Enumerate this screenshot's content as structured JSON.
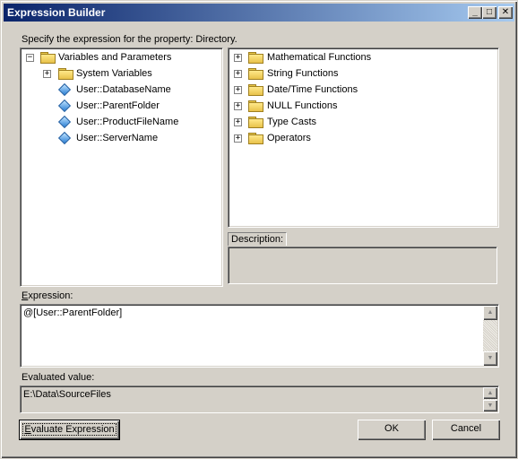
{
  "window": {
    "title": "Expression Builder",
    "controls": {
      "minimize": "_",
      "maximize": "□",
      "close": "✕"
    }
  },
  "prompt_label": "Specify the expression for the property: Directory.",
  "variables_tree": {
    "root": {
      "label": "Variables and Parameters",
      "expander": "−",
      "icon": "folder-open-icon"
    },
    "children": [
      {
        "label": "System Variables",
        "expander": "+",
        "icon": "folder-icon"
      },
      {
        "label": "User::DatabaseName",
        "icon": "variable-icon"
      },
      {
        "label": "User::ParentFolder",
        "icon": "variable-icon"
      },
      {
        "label": "User::ProductFileName",
        "icon": "variable-icon"
      },
      {
        "label": "User::ServerName",
        "icon": "variable-icon"
      }
    ]
  },
  "functions_tree": {
    "items": [
      {
        "label": "Mathematical Functions",
        "expander": "+"
      },
      {
        "label": "String Functions",
        "expander": "+"
      },
      {
        "label": "Date/Time Functions",
        "expander": "+"
      },
      {
        "label": "NULL Functions",
        "expander": "+"
      },
      {
        "label": "Type Casts",
        "expander": "+"
      },
      {
        "label": "Operators",
        "expander": "+"
      }
    ]
  },
  "description": {
    "label": "Description:",
    "value": ""
  },
  "expression": {
    "label_accel": "E",
    "label_rest": "xpression:",
    "value": "@[User::ParentFolder]"
  },
  "evaluated": {
    "label": "Evaluated value:",
    "value": "E:\\Data\\SourceFiles"
  },
  "buttons": {
    "evaluate_accel": "E",
    "evaluate_rest": "valuate Expression",
    "ok": "OK",
    "cancel": "Cancel"
  },
  "colors": {
    "titlebar_start": "#0a246a",
    "titlebar_end": "#a6caf0",
    "face": "#d4d0c8"
  }
}
